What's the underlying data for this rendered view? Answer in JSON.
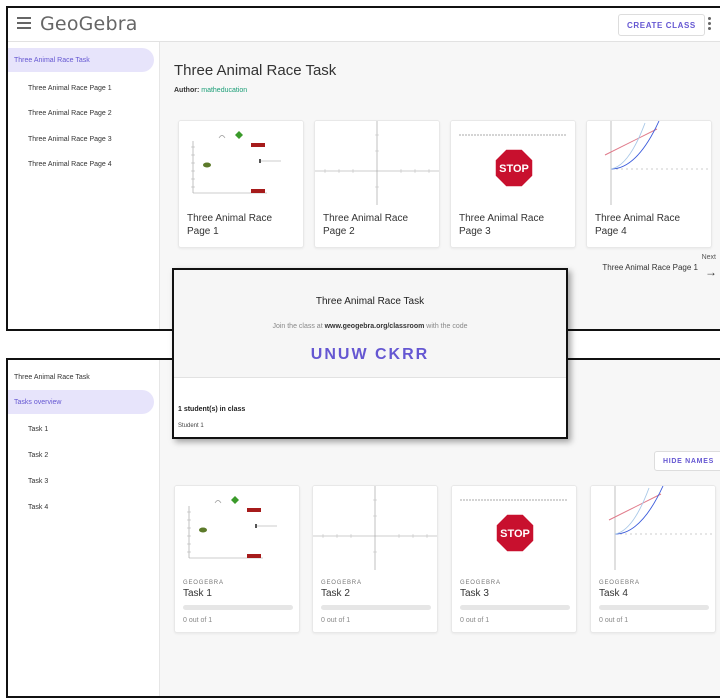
{
  "top_window": {
    "logo": "GeoGebra",
    "create_class_label": "CREATE CLASS",
    "sidebar": [
      "Three Animal Race Task",
      "Three Animal Race Page 1",
      "Three Animal Race Page 2",
      "Three Animal Race Page 3",
      "Three Animal Race Page 4"
    ],
    "title": "Three Animal Race Task",
    "author_label": "Author:",
    "author_name": "matheducation",
    "cards": [
      {
        "title": "Three Animal Race Page 1"
      },
      {
        "title": "Three Animal Race Page 2"
      },
      {
        "title": "Three Animal Race Page 3"
      },
      {
        "title": "Three Animal Race Page 4"
      }
    ],
    "next_label": "Next",
    "next_title": "Three Animal Race Page 1",
    "thumb_stop_text": "STOP"
  },
  "modal": {
    "title": "Three Animal Race Task",
    "join_prefix": "Join the class at",
    "join_url": "www.geogebra.org/classroom",
    "join_suffix": "with the code",
    "code": "UNUW CKRR",
    "students_count": "1 student(s) in class",
    "students": [
      "Student 1"
    ]
  },
  "bottom_window": {
    "sidebar": [
      "Three Animal Race Task",
      "Tasks overview",
      "Task 1",
      "Task 2",
      "Task 3",
      "Task 4"
    ],
    "hide_names_label": "HIDE NAMES",
    "cards": [
      {
        "provider": "GEOGEBRA",
        "title": "Task 1",
        "score": "0 out of 1"
      },
      {
        "provider": "GEOGEBRA",
        "title": "Task 2",
        "score": "0 out of 1"
      },
      {
        "provider": "GEOGEBRA",
        "title": "Task 3",
        "score": "0 out of 1"
      },
      {
        "provider": "GEOGEBRA",
        "title": "Task 4",
        "score": "0 out of 1"
      }
    ]
  },
  "colors": {
    "accent": "#6557d2",
    "author": "#1b9e77",
    "stop_red": "#c8102e"
  }
}
